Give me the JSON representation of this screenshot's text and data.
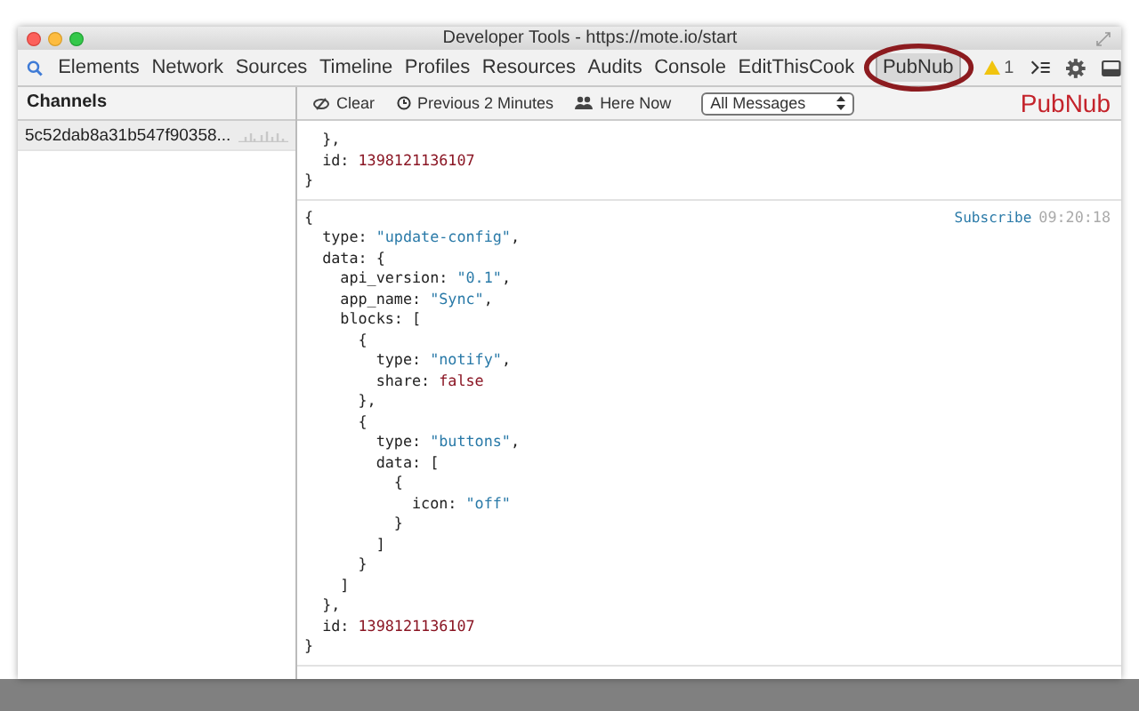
{
  "window": {
    "title": "Developer Tools - https://mote.io/start"
  },
  "tabs": [
    {
      "label": "Elements",
      "selected": false,
      "circled": false
    },
    {
      "label": "Network",
      "selected": false,
      "circled": false
    },
    {
      "label": "Sources",
      "selected": false,
      "circled": false
    },
    {
      "label": "Timeline",
      "selected": false,
      "circled": false
    },
    {
      "label": "Profiles",
      "selected": false,
      "circled": false
    },
    {
      "label": "Resources",
      "selected": false,
      "circled": false
    },
    {
      "label": "Audits",
      "selected": false,
      "circled": false
    },
    {
      "label": "Console",
      "selected": false,
      "circled": false
    },
    {
      "label": "EditThisCook",
      "selected": false,
      "circled": false
    },
    {
      "label": "PubNub",
      "selected": true,
      "circled": true
    }
  ],
  "warnings": {
    "count": "1"
  },
  "sidebar": {
    "title": "Channels",
    "items": [
      {
        "label": "5c52dab8a31b547f90358...",
        "selected": true
      }
    ]
  },
  "toolbar": {
    "clear": "Clear",
    "previous": "Previous 2 Minutes",
    "here_now": "Here Now",
    "filter": {
      "value": "All Messages"
    },
    "logo": "PubNub"
  },
  "messages": [
    {
      "lines": [
        [
          {
            "kind": "plain",
            "text": "  },"
          }
        ],
        [
          {
            "kind": "plain",
            "text": "  id: "
          },
          {
            "kind": "number",
            "text": "1398121136107"
          }
        ],
        [
          {
            "kind": "plain",
            "text": "}"
          }
        ]
      ]
    },
    {
      "action": "Subscribe",
      "time": "09:20:18",
      "lines": [
        [
          {
            "kind": "plain",
            "text": "{"
          }
        ],
        [
          {
            "kind": "plain",
            "text": "  type: "
          },
          {
            "kind": "string",
            "text": "\"update-config\""
          },
          {
            "kind": "plain",
            "text": ","
          }
        ],
        [
          {
            "kind": "plain",
            "text": "  data: {"
          }
        ],
        [
          {
            "kind": "plain",
            "text": "    api_version: "
          },
          {
            "kind": "string",
            "text": "\"0.1\""
          },
          {
            "kind": "plain",
            "text": ","
          }
        ],
        [
          {
            "kind": "plain",
            "text": "    app_name: "
          },
          {
            "kind": "string",
            "text": "\"Sync\""
          },
          {
            "kind": "plain",
            "text": ","
          }
        ],
        [
          {
            "kind": "plain",
            "text": "    blocks: ["
          }
        ],
        [
          {
            "kind": "plain",
            "text": "      {"
          }
        ],
        [
          {
            "kind": "plain",
            "text": "        type: "
          },
          {
            "kind": "string",
            "text": "\"notify\""
          },
          {
            "kind": "plain",
            "text": ","
          }
        ],
        [
          {
            "kind": "plain",
            "text": "        share: "
          },
          {
            "kind": "number",
            "text": "false"
          }
        ],
        [
          {
            "kind": "plain",
            "text": "      },"
          }
        ],
        [
          {
            "kind": "plain",
            "text": "      {"
          }
        ],
        [
          {
            "kind": "plain",
            "text": "        type: "
          },
          {
            "kind": "string",
            "text": "\"buttons\""
          },
          {
            "kind": "plain",
            "text": ","
          }
        ],
        [
          {
            "kind": "plain",
            "text": "        data: ["
          }
        ],
        [
          {
            "kind": "plain",
            "text": "          {"
          }
        ],
        [
          {
            "kind": "plain",
            "text": "            icon: "
          },
          {
            "kind": "string",
            "text": "\"off\""
          }
        ],
        [
          {
            "kind": "plain",
            "text": "          }"
          }
        ],
        [
          {
            "kind": "plain",
            "text": "        ]"
          }
        ],
        [
          {
            "kind": "plain",
            "text": "      }"
          }
        ],
        [
          {
            "kind": "plain",
            "text": "    ]"
          }
        ],
        [
          {
            "kind": "plain",
            "text": "  },"
          }
        ],
        [
          {
            "kind": "plain",
            "text": "  id: "
          },
          {
            "kind": "number",
            "text": "1398121136107"
          }
        ],
        [
          {
            "kind": "plain",
            "text": "}"
          }
        ]
      ]
    }
  ]
}
